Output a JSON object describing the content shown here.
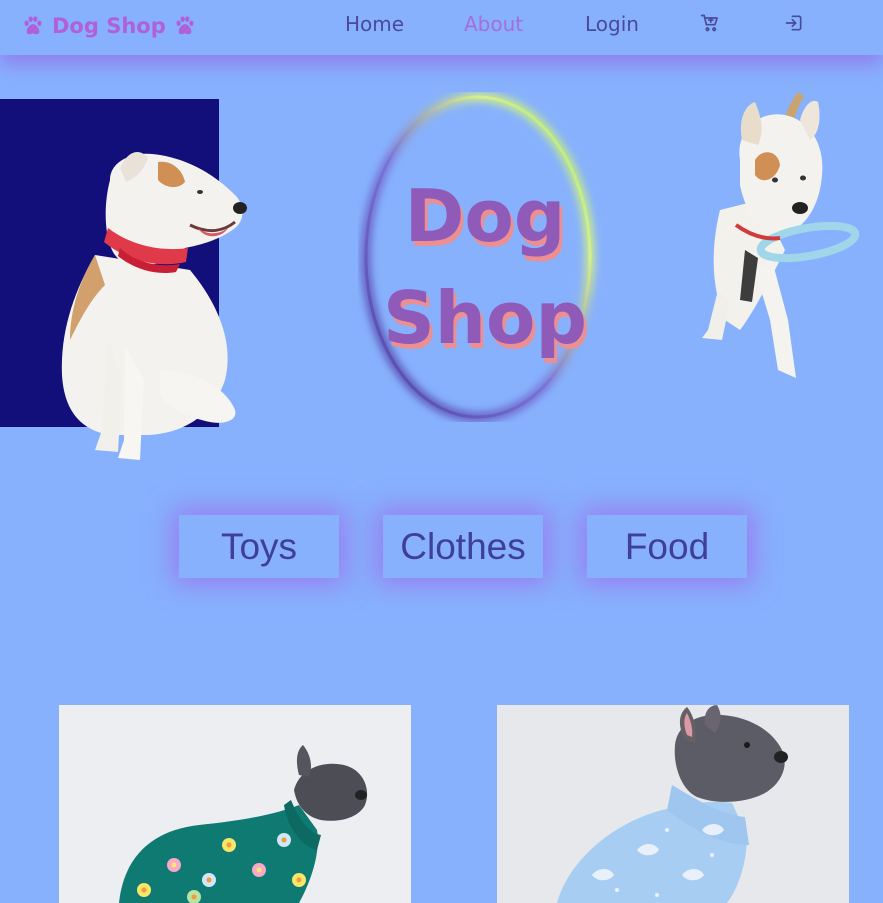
{
  "nav": {
    "brand": "Dog Shop",
    "links": [
      {
        "label": "Home",
        "active": false
      },
      {
        "label": "About",
        "active": true
      },
      {
        "label": "Login",
        "active": false
      }
    ],
    "icons": [
      "paw-icon",
      "cart-icon",
      "login-icon"
    ]
  },
  "hero": {
    "title_line1": "Dog",
    "title_line2": "Shop"
  },
  "categories": [
    {
      "label": "Toys"
    },
    {
      "label": "Clothes"
    },
    {
      "label": "Food"
    }
  ],
  "colors": {
    "background": "#87b1fd",
    "brand": "#b060d8",
    "nav_text": "#4a4a9a",
    "nav_active": "#a56fd6",
    "title": "#8f5ab8",
    "title_shadow": "#ec8f92",
    "glow": "#a05feb",
    "dark_panel": "#120f7a"
  }
}
